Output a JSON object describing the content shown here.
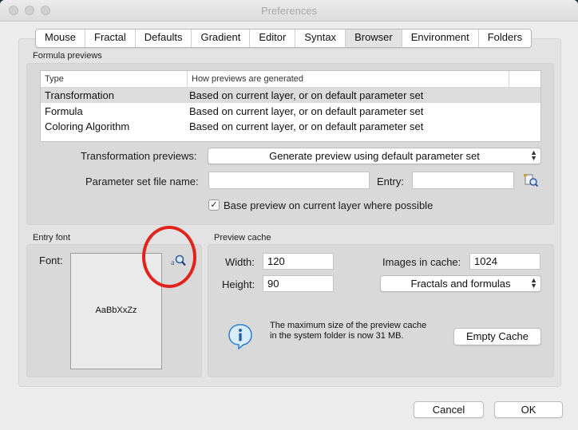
{
  "window": {
    "title": "Preferences"
  },
  "tabs": [
    "Mouse",
    "Fractal",
    "Defaults",
    "Gradient",
    "Editor",
    "Syntax",
    "Browser",
    "Environment",
    "Folders"
  ],
  "formula_previews": {
    "group_label": "Formula previews",
    "columns": [
      "Type",
      "How previews are generated"
    ],
    "rows": [
      {
        "type": "Transformation",
        "how": "Based on current layer, or on default parameter set"
      },
      {
        "type": "Formula",
        "how": "Based on current layer, or on default parameter set"
      },
      {
        "type": "Coloring Algorithm",
        "how": "Based on current layer, or on default parameter set"
      }
    ],
    "transformation_label": "Transformation previews:",
    "transformation_value": "Generate preview using default parameter set",
    "param_file_label": "Parameter set file name:",
    "param_file_value": "",
    "entry_label": "Entry:",
    "entry_value": "",
    "base_preview_checked": true,
    "base_preview_label": "Base preview on current layer where possible"
  },
  "entry_font": {
    "group_label": "Entry font",
    "font_label": "Font:",
    "sample": "AaBbXxZz"
  },
  "preview_cache": {
    "group_label": "Preview cache",
    "width_label": "Width:",
    "width_value": "120",
    "height_label": "Height:",
    "height_value": "90",
    "images_label": "Images in cache:",
    "images_value": "1024",
    "scope_value": "Fractals and formulas",
    "info_text": "The maximum size of the preview cache in the system folder is now 31 MB.",
    "empty_cache_label": "Empty Cache"
  },
  "footer": {
    "cancel_label": "Cancel",
    "ok_label": "OK"
  },
  "colors": {
    "highlight_circle": "#e3231b",
    "info_icon": "#2a7fd4"
  }
}
